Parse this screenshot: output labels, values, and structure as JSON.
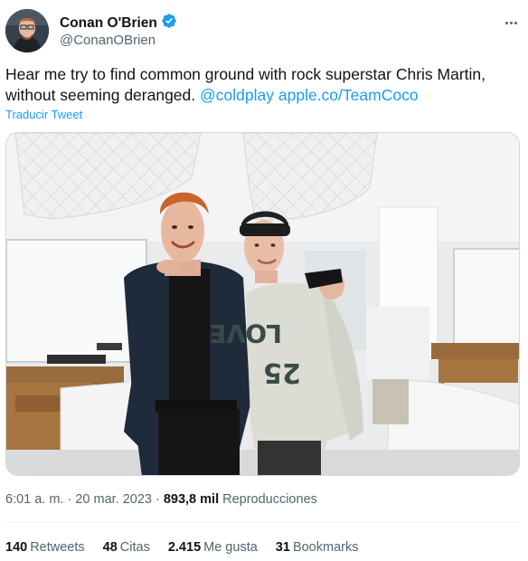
{
  "author": {
    "display_name": "Conan O'Brien",
    "handle": "@ConanOBrien"
  },
  "tweet": {
    "text": "Hear me try to find common ground with rock superstar Chris Martin, without seeming deranged.",
    "mention": "@coldplay",
    "url": "apple.co/TeamCoco",
    "translate_label": "Traducir Tweet"
  },
  "photo": {
    "shirt_text_line1": "LOVE",
    "shirt_text_line2": "25"
  },
  "meta": {
    "time": "6:01 a. m.",
    "separator": "·",
    "date": "20 mar. 2023",
    "views_count": "893,8 mil",
    "views_label": "Reproducciones"
  },
  "stats": {
    "retweets_count": "140",
    "retweets_label": "Retweets",
    "quotes_count": "48",
    "quotes_label": "Citas",
    "likes_count": "2.415",
    "likes_label": "Me gusta",
    "bookmarks_count": "31",
    "bookmarks_label": "Bookmarks"
  },
  "colors": {
    "link": "#1d9bf0",
    "text": "#0f1419",
    "secondary": "#536471",
    "verified": "#1d9bf0"
  },
  "icons": [
    "verified-badge-icon",
    "more-options-icon"
  ]
}
